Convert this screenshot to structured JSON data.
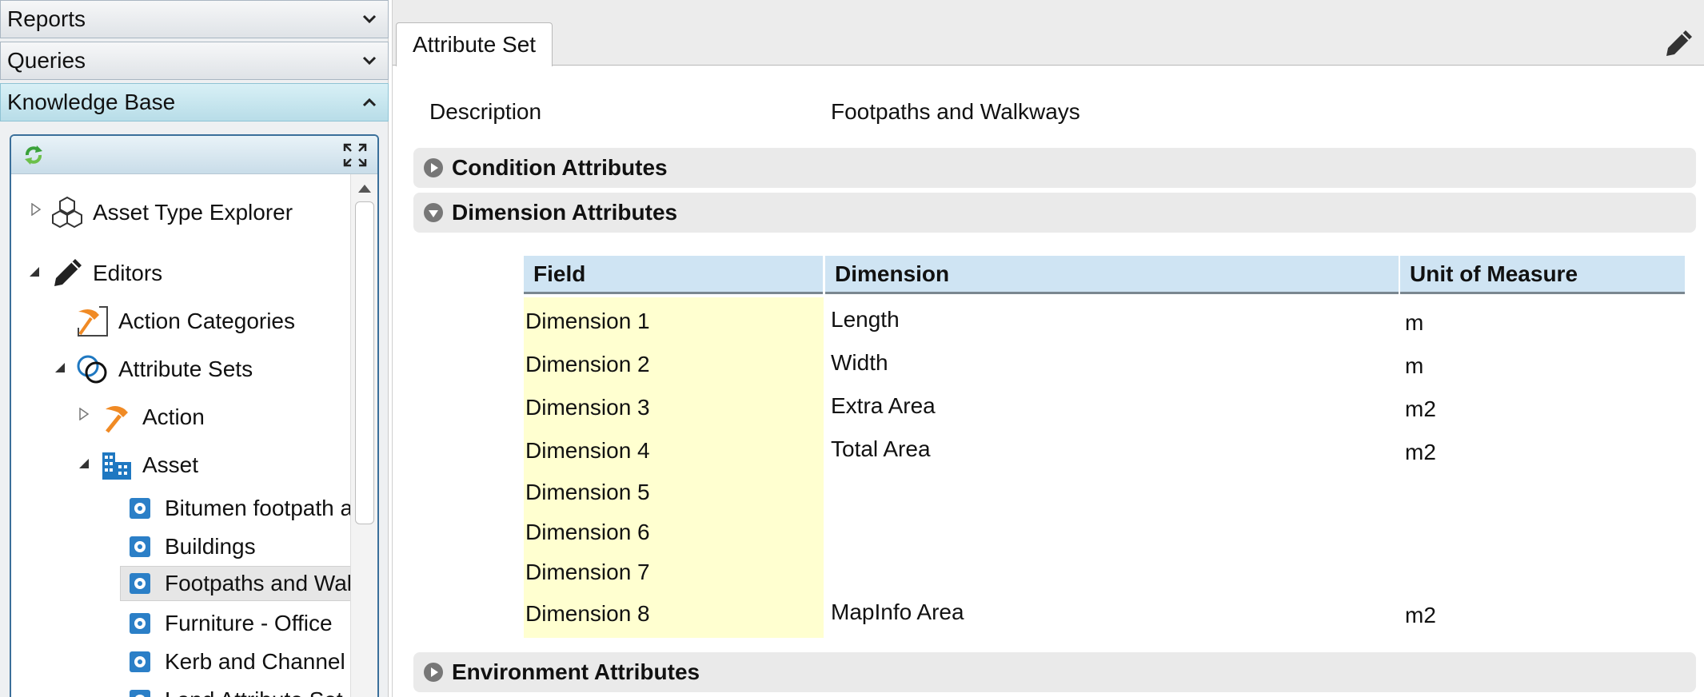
{
  "accordion": {
    "reports": "Reports",
    "queries": "Queries",
    "knowledge_base": "Knowledge Base"
  },
  "tree": {
    "asset_type_explorer": "Asset Type Explorer",
    "editors": "Editors",
    "action_categories": "Action Categories",
    "attribute_sets": "Attribute Sets",
    "action": "Action",
    "asset": "Asset",
    "leaves": [
      "Bitumen footpath a",
      "Buildings",
      "Footpaths and Wal",
      "Furniture - Office",
      "Kerb and Channel",
      "Land Attribute Set"
    ]
  },
  "tab": {
    "label": "Attribute Set"
  },
  "description": {
    "label": "Description",
    "value": "Footpaths and Walkways"
  },
  "sections": {
    "condition": "Condition Attributes",
    "dimension": "Dimension Attributes",
    "environment": "Environment Attributes"
  },
  "grid": {
    "headers": {
      "field": "Field",
      "dimension": "Dimension",
      "unit": "Unit of Measure"
    },
    "rows": [
      {
        "field": "Dimension 1",
        "dimension": "Length",
        "unit": "m"
      },
      {
        "field": "Dimension 2",
        "dimension": "Width",
        "unit": "m"
      },
      {
        "field": "Dimension 3",
        "dimension": "Extra Area",
        "unit": "m2"
      },
      {
        "field": "Dimension 4",
        "dimension": "Total Area",
        "unit": "m2"
      },
      {
        "field": "Dimension 5",
        "dimension": "",
        "unit": ""
      },
      {
        "field": "Dimension 6",
        "dimension": "",
        "unit": ""
      },
      {
        "field": "Dimension 7",
        "dimension": "",
        "unit": ""
      },
      {
        "field": "Dimension 8",
        "dimension": "MapInfo Area",
        "unit": "m2"
      }
    ]
  },
  "colors": {
    "header_blue": "#cfe4f3",
    "field_yellow": "#ffffd0",
    "accent_orange": "#f08a24",
    "accent_blue": "#1f78c1"
  }
}
